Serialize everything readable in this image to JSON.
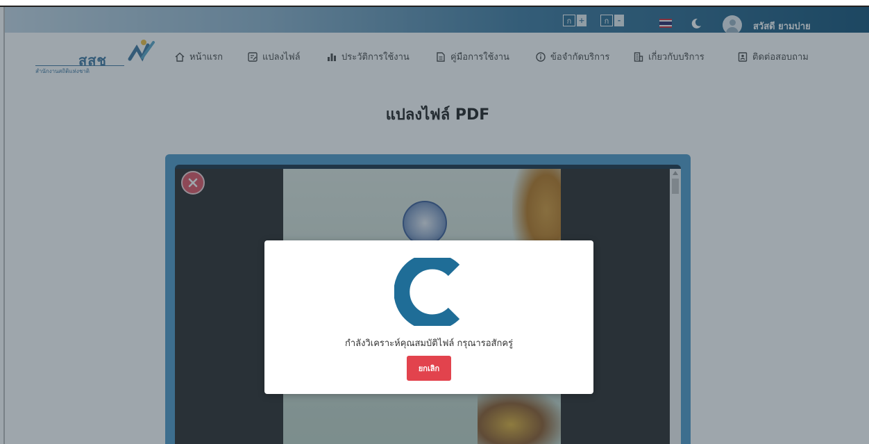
{
  "topbar": {
    "font_increase": {
      "label": "ก",
      "sign": "+"
    },
    "font_decrease": {
      "label": "ก",
      "sign": "-"
    },
    "language_flag": "thai-flag-icon",
    "theme_icon": "moon-icon",
    "greeting": "สวัสดี ยามบ่าย"
  },
  "logo": {
    "main": "สสช",
    "sub": "สำนักงานสถิติแห่งชาติ"
  },
  "nav": {
    "items": [
      {
        "label": "หน้าแรก",
        "icon": "home-icon"
      },
      {
        "label": "แปลงไฟล์",
        "icon": "edit-file-icon"
      },
      {
        "label": "ประวัติการใช้งาน",
        "icon": "bar-chart-icon"
      },
      {
        "label": "คู่มือการใช้งาน",
        "icon": "document-icon"
      },
      {
        "label": "ข้อจำกัดบริการ",
        "icon": "info-icon"
      },
      {
        "label": "เกี่ยวกับบริการ",
        "icon": "building-icon"
      },
      {
        "label": "ติดต่อสอบถาม",
        "icon": "contact-book-icon"
      }
    ]
  },
  "main": {
    "title": "แปลงไฟล์ PDF"
  },
  "modal": {
    "message": "กำลังวิเคราะห์คุณสมบัติไฟล์ กรุณารอสักครู่",
    "cancel_label": "ยกเลิก"
  },
  "colors": {
    "brand": "#3f77a0",
    "danger": "#e2434d",
    "spinner": "#1f6d97"
  }
}
